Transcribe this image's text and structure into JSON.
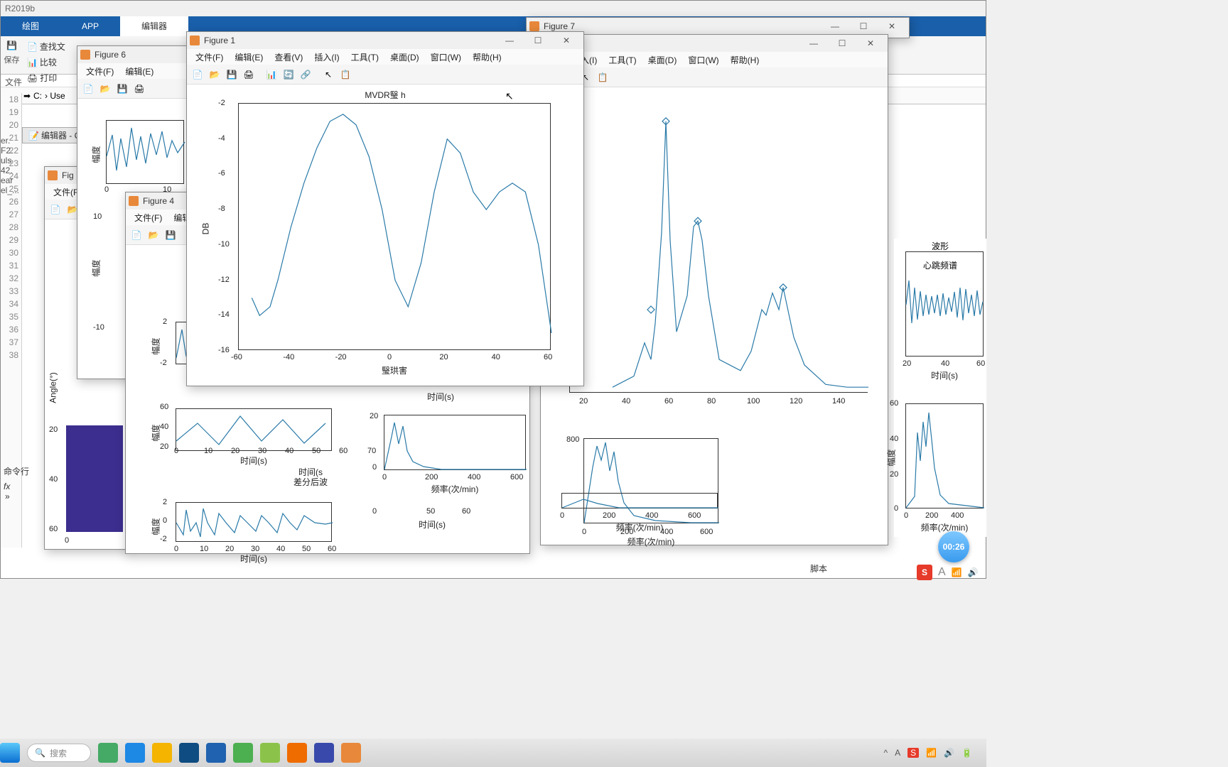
{
  "app_title": "R2019b",
  "ribbon": {
    "tabs": [
      "绘图",
      "APP",
      "编辑器"
    ],
    "active": 2
  },
  "toolbar": {
    "save": "保存",
    "find": "查找文",
    "compare": "比较",
    "print": "打印",
    "group_label": "文件"
  },
  "path_bar": {
    "drive": "C:",
    "folder": "› Use"
  },
  "side_items": [
    "er.",
    "F2.",
    "uls",
    "42.",
    "ear",
    "el_..."
  ],
  "line_start": 18,
  "line_count": 21,
  "editor_tab": "编辑器 - C",
  "cmd_label": "命令行",
  "fx_icon": "fx",
  "figure1": {
    "title": "Figure 1",
    "menus": [
      "文件(F)",
      "编辑(E)",
      "查看(V)",
      "插入(I)",
      "工具(T)",
      "桌面(D)",
      "窗口(W)",
      "帮助(H)"
    ]
  },
  "figure7": {
    "title": "Figure 7",
    "menus": [
      "(V)",
      "插入(I)",
      "工具(T)",
      "桌面(D)",
      "窗口(W)",
      "帮助(H)"
    ]
  },
  "figure6": {
    "title": "Figure 6",
    "menus": [
      "文件(F)",
      "编辑(E)"
    ]
  },
  "figure4": {
    "title": "Figure 4",
    "menu1": "文件(F)",
    "menu2": "编辑"
  },
  "other_fig": {
    "menu1": "文件(F"
  },
  "sub_axis_labels": {
    "time": "时间(s)",
    "freq": "频率(次/min)",
    "amp": "幅度",
    "angle": "Angle(°)",
    "heartbeat_spectrum": "心跳频谱",
    "waveform": "波形",
    "diff_waveform": "差分后波",
    "time_partial": "时间(s",
    "spectrum_partial": "谱"
  },
  "status_foot": "脚本",
  "search_placeholder": "搜索",
  "timer": "00:26",
  "sys_tray": {
    "ime": "S",
    "font": "A"
  },
  "chart_data": [
    {
      "type": "line",
      "title": "MVDR瑿 h",
      "xlabel": "瑿珙害",
      "ylabel": "DB",
      "xlim": [
        -60,
        60
      ],
      "ylim": [
        -16,
        -2
      ],
      "xticks": [
        -60,
        -40,
        -20,
        0,
        20,
        40,
        60
      ],
      "yticks": [
        -16,
        -14,
        -12,
        -10,
        -8,
        -6,
        -4,
        -2
      ],
      "x": [
        -55,
        -52,
        -48,
        -45,
        -40,
        -35,
        -30,
        -25,
        -20,
        -15,
        -10,
        -5,
        0,
        5,
        10,
        15,
        20,
        25,
        30,
        35,
        40,
        45,
        50,
        55,
        60
      ],
      "y": [
        -13,
        -14,
        -13.5,
        -12,
        -9,
        -6.5,
        -4.5,
        -3,
        -2.6,
        -3.2,
        -5,
        -8,
        -12,
        -13.5,
        -11,
        -7,
        -4,
        -4.8,
        -7,
        -8,
        -7,
        -6.5,
        -7,
        -10,
        -15
      ]
    },
    {
      "type": "line",
      "title": "",
      "xlabel": "",
      "ylabel": "",
      "xlim": [
        0,
        140
      ],
      "ylim": [
        0,
        1
      ],
      "xticks": [
        20,
        40,
        60,
        80,
        100,
        120,
        140
      ],
      "x": [
        20,
        30,
        35,
        38,
        40,
        43,
        45,
        47,
        50,
        55,
        58,
        60,
        62,
        65,
        70,
        80,
        85,
        90,
        92,
        95,
        98,
        100,
        105,
        110,
        120,
        130,
        140
      ],
      "y": [
        0.02,
        0.06,
        0.18,
        0.12,
        0.25,
        0.58,
        0.98,
        0.55,
        0.22,
        0.35,
        0.6,
        0.62,
        0.55,
        0.35,
        0.12,
        0.08,
        0.15,
        0.3,
        0.28,
        0.36,
        0.3,
        0.38,
        0.2,
        0.1,
        0.03,
        0.02,
        0.02
      ],
      "markers": [
        {
          "x": 38,
          "y": 0.3
        },
        {
          "x": 45,
          "y": 0.98
        },
        {
          "x": 60,
          "y": 0.62
        },
        {
          "x": 100,
          "y": 0.38
        }
      ]
    }
  ]
}
